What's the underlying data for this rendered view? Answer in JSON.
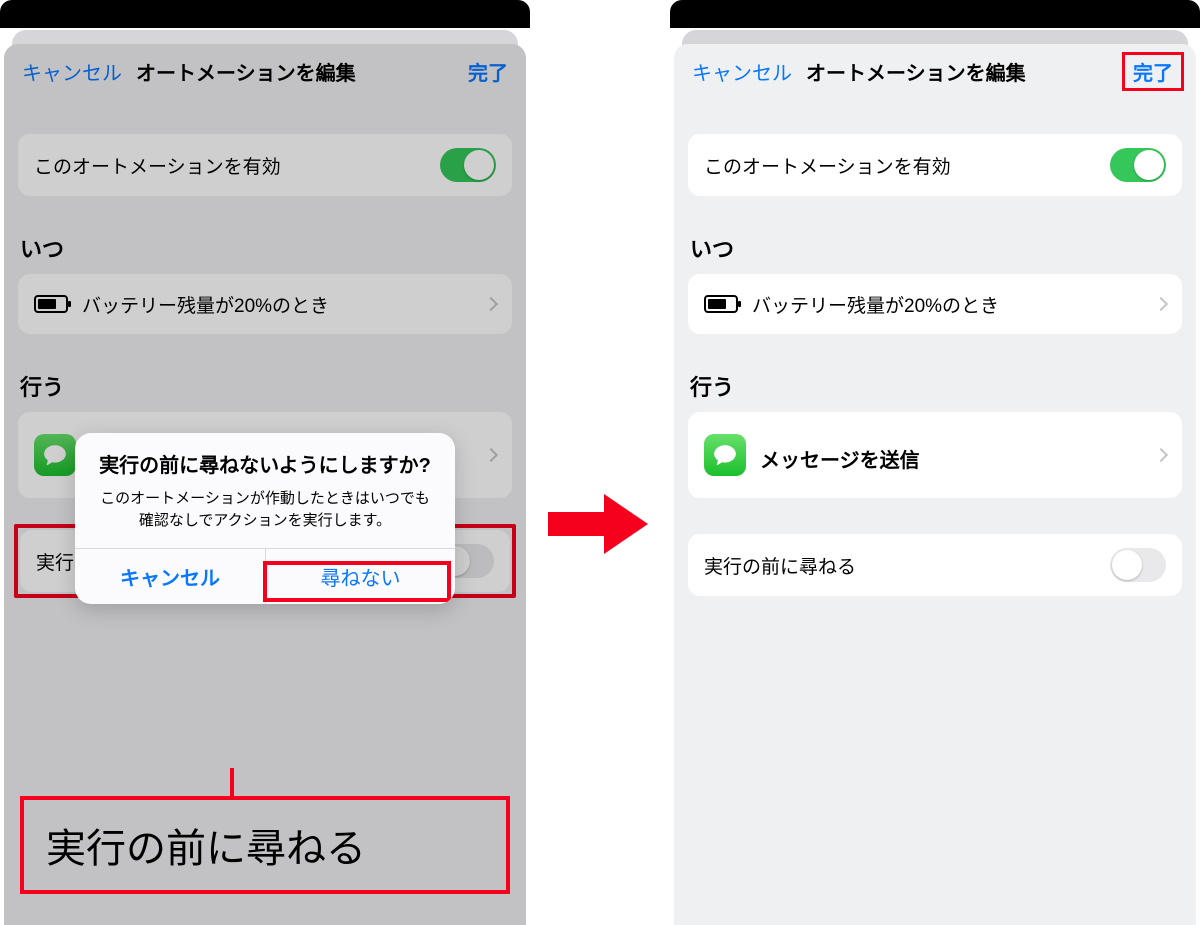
{
  "nav": {
    "cancel": "キャンセル",
    "title": "オートメーションを編集",
    "done": "完了"
  },
  "rows": {
    "enable": "このオートメーションを有効",
    "ask_before": "実行の前に尋ねる"
  },
  "sections": {
    "when": "いつ",
    "do": "行う"
  },
  "when": {
    "battery": "バッテリー残量が20%のとき"
  },
  "do": {
    "action_title": "メッセージを送信"
  },
  "alert": {
    "title": "実行の前に尋ねないようにしますか?",
    "message": "このオートメーションが作動したときはいつでも確認なしでアクションを実行します。",
    "cancel": "キャンセル",
    "confirm": "尋ねない"
  },
  "callout": {
    "text": "実行の前に尋ねる"
  },
  "colors": {
    "accent": "#0a77ff",
    "highlight": "#f5001d",
    "toggle_on": "#35c759"
  }
}
